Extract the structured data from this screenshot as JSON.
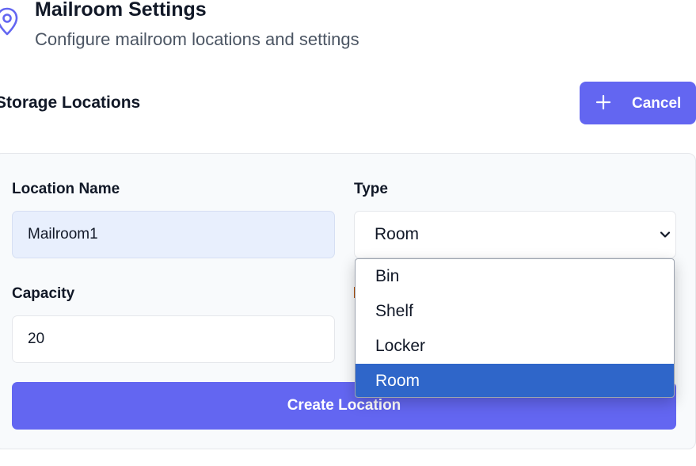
{
  "header": {
    "title": "Mailroom Settings",
    "subtitle": "Configure mailroom locations and settings",
    "icon": "map-pin-icon"
  },
  "section": {
    "title": "Storage Locations",
    "cancel_label": "Cancel",
    "cancel_icon": "plus-icon"
  },
  "form": {
    "location_name_label": "Location Name",
    "location_name_value": "Mailroom1",
    "type_label": "Type",
    "type_value": "Room",
    "capacity_label": "Capacity",
    "capacity_value": "20",
    "submit_label": "Create Location",
    "type_options": [
      "Bin",
      "Shelf",
      "Locker",
      "Room"
    ],
    "selected_option": "Room"
  },
  "colors": {
    "accent": "#6366f1",
    "selected_option_bg": "#2f66c9",
    "filled_input_bg": "#e8effd"
  }
}
